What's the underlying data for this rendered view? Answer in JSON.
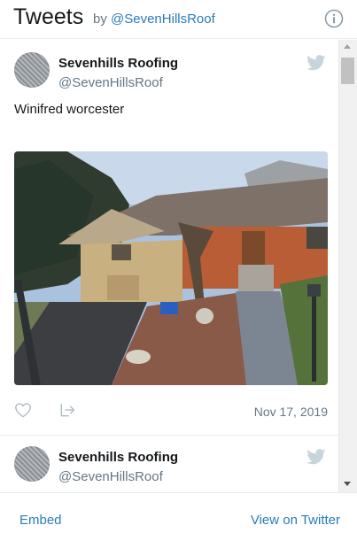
{
  "header": {
    "title": "Tweets",
    "by_prefix": "by",
    "handle": "@SevenHillsRoof",
    "info_icon": "info-circle-icon"
  },
  "tweets": [
    {
      "name": "Sevenhills Roofing",
      "screen_name": "@SevenHillsRoof",
      "text": "Winifred worcester",
      "timestamp": "Nov 17, 2019",
      "media": "photo of a brick ranch house with a new shingle roof and stone walkway",
      "icons": [
        "twitter-bird-icon",
        "heart-icon",
        "share-icon"
      ]
    },
    {
      "name": "Sevenhills Roofing",
      "screen_name": "@SevenHillsRoof",
      "icons": [
        "twitter-bird-icon"
      ]
    }
  ],
  "footer": {
    "embed": "Embed",
    "view_on_twitter": "View on Twitter"
  },
  "colors": {
    "link": "#2b7bb9",
    "muted": "#657786",
    "text": "#14171a",
    "divider": "#e6ecf0"
  }
}
